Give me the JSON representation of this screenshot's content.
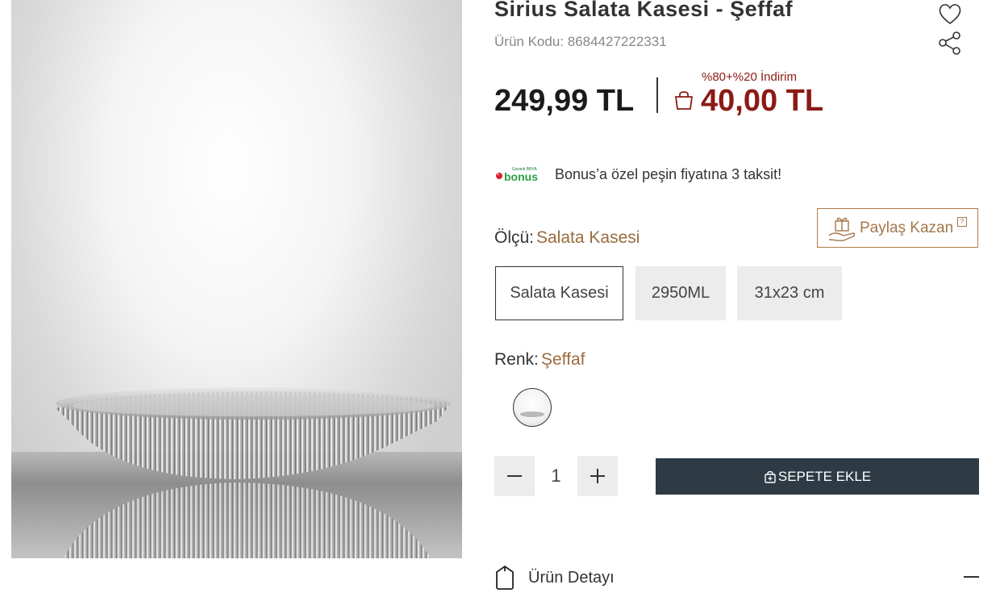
{
  "product": {
    "title": "Sirius Salata Kasesi - Şeffaf",
    "sku_label": "Ürün Kodu:",
    "sku_value": "8684427222331"
  },
  "actions": {
    "favorite_icon": "heart-icon",
    "share_icon": "share-icon"
  },
  "pricing": {
    "list_price": "249,99 TL",
    "discount_label": "%80+%20 İndirim",
    "cart_price": "40,00 TL",
    "discount_color": "#8b1a14"
  },
  "bonus": {
    "logo_text": "bonus",
    "logo_subtext": "Garanti BBVA",
    "message": "Bonus’a özel peşin fiyatına 3 taksit!"
  },
  "share_earn": {
    "label": "Paylaş Kazan",
    "help": "?"
  },
  "size": {
    "label": "Ölçü:",
    "selected": "Salata Kasesi",
    "options": [
      "Salata Kasesi",
      "2950ML",
      "31x23 cm"
    ]
  },
  "color": {
    "label": "Renk:",
    "selected": "Şeffaf"
  },
  "quantity": {
    "value": "1"
  },
  "cart": {
    "add_label": "SEPETE EKLE",
    "button_color": "#2f3b44"
  },
  "details": {
    "label": "Ürün Detayı"
  }
}
